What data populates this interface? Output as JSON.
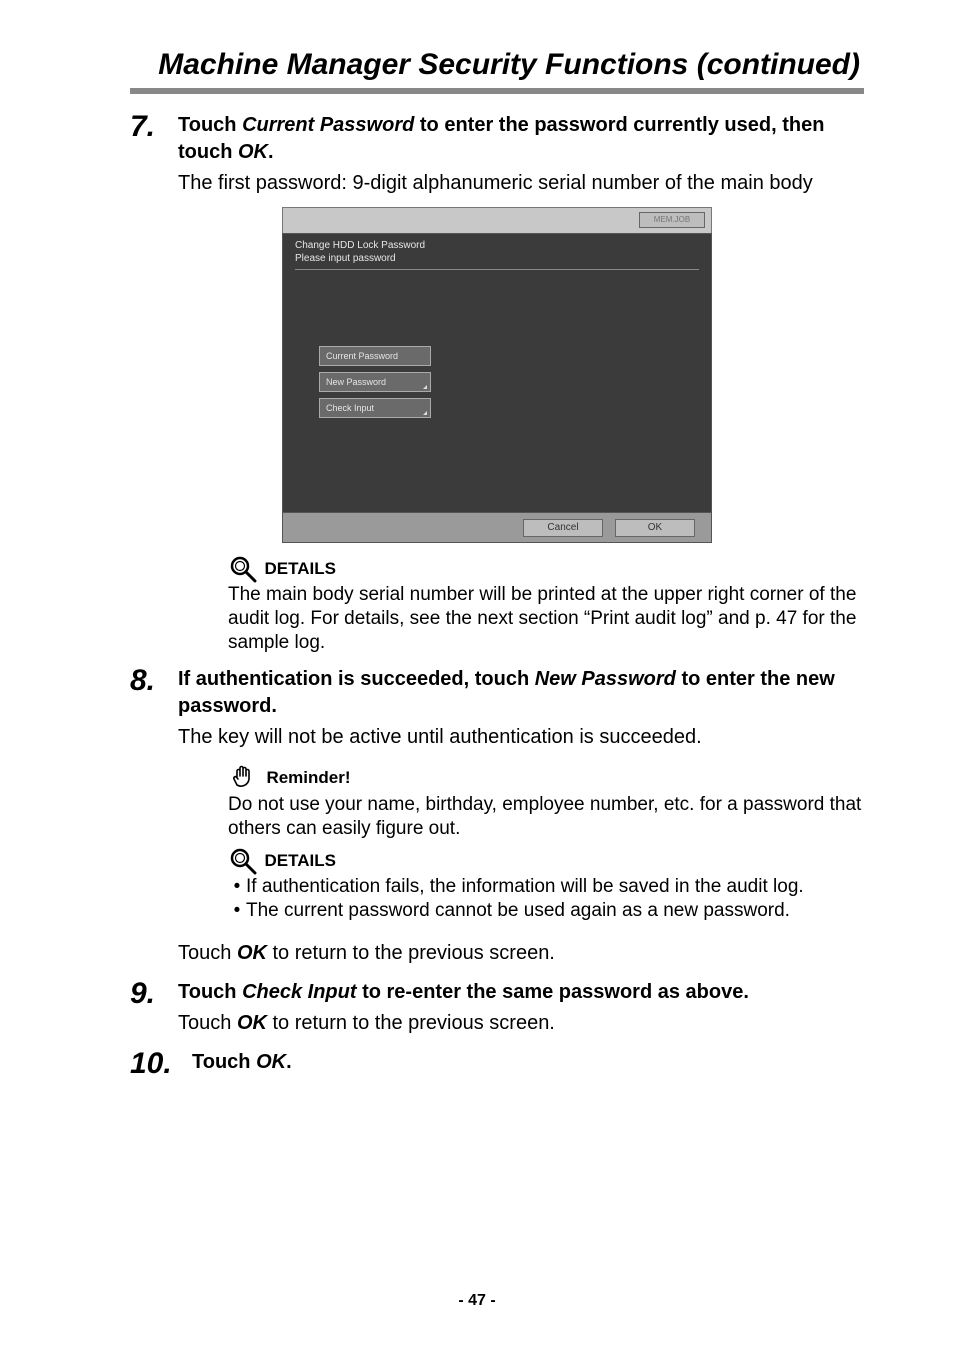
{
  "title": "Machine Manager Security Functions (continued)",
  "steps": {
    "s7": {
      "num": "7.",
      "head_parts": [
        "Touch ",
        "Current Password",
        " to enter the password currently used, then touch ",
        "OK",
        "."
      ],
      "plain": "The first password: 9-digit alphanumeric serial number of the main body"
    },
    "s8": {
      "num": "8.",
      "head_parts": [
        "If authentication is succeeded, touch ",
        "New Password",
        " to enter the new password."
      ],
      "plain": "The key will not be active until authentication is succeeded."
    },
    "s9": {
      "num": "9.",
      "head_parts": [
        "Touch ",
        "Check Input",
        " to re-enter the same password as above."
      ],
      "plain_parts": [
        "Touch ",
        "OK",
        " to return to the previous screen."
      ]
    },
    "s10": {
      "num": "10.",
      "head_parts": [
        "Touch ",
        "OK",
        "."
      ]
    }
  },
  "panel": {
    "mjbtn": "MEM.JOB",
    "line1": "Change HDD Lock Password",
    "line2": "Please input password",
    "btn_current": "Current Password",
    "btn_new": "New Password",
    "btn_check": "Check Input",
    "cancel": "Cancel",
    "ok": "OK"
  },
  "details1": {
    "label": "DETAILS",
    "body": "The main body serial number will be printed at the upper right corner of the audit log. For details, see the next section “Print audit log” and p. 47 for the sample log."
  },
  "reminder": {
    "label": "Reminder!",
    "body": "Do not use your name, birthday, employee number, etc. for a password that others can easily figure out."
  },
  "details2": {
    "label": "DETAILS",
    "b1": "If authentication fails, the information will be saved in the audit log.",
    "b2": "The current password cannot be used again as a new password."
  },
  "return_line_parts": [
    "Touch ",
    "OK",
    " to return to the previous screen."
  ],
  "page_number": "- 47 -"
}
